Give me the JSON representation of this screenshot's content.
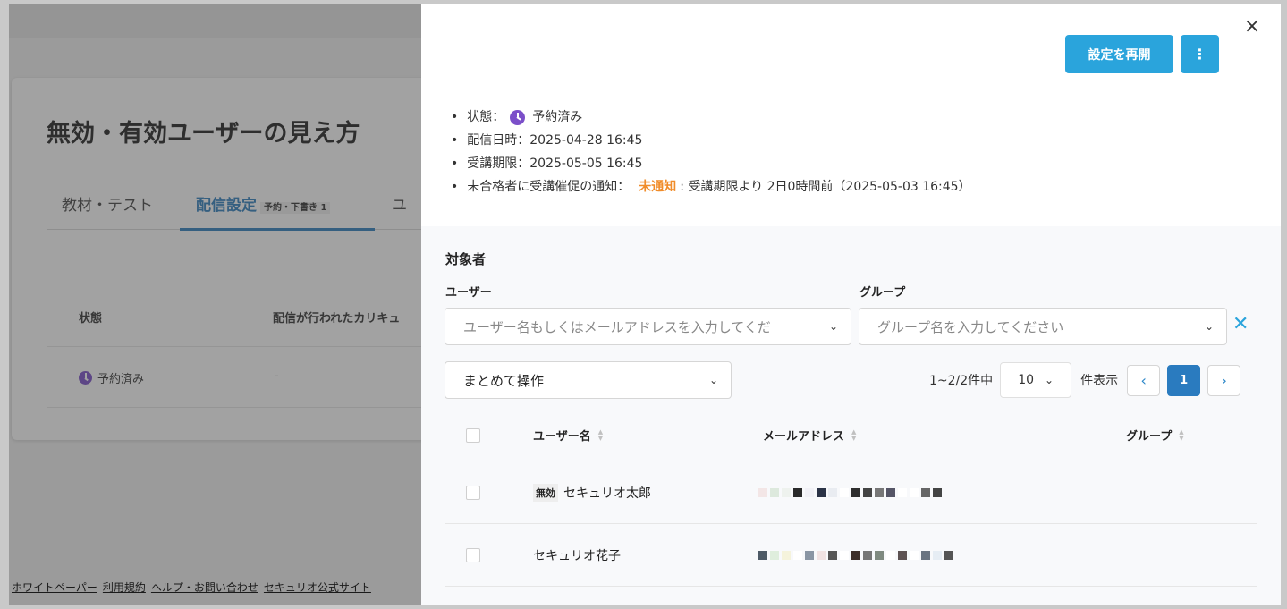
{
  "background": {
    "page_title": "無効・有効ユーザーの見え方",
    "tabs": [
      {
        "label": "教材・テスト"
      },
      {
        "label": "配信設定",
        "badge": "予約・下書き 1"
      },
      {
        "label": "ユ"
      }
    ],
    "table_headers": [
      "状態",
      "配信が行われたカリキュ"
    ],
    "row": {
      "status": "予約済み",
      "curriculum": "-"
    },
    "footer_links": [
      "ホワイトペーパー",
      "利用規約",
      "ヘルプ・お問い合わせ",
      "セキュリオ公式サイト"
    ]
  },
  "drawer": {
    "close_icon": "×",
    "resume_button": "設定を再開",
    "more_button": "⋮",
    "info": {
      "status_label": "状態：",
      "status_value": "予約済み",
      "delivery_label": "配信日時：",
      "delivery_value": "2025-04-28 16:45",
      "deadline_label": "受講期限：",
      "deadline_value": "2025-05-05 16:45",
      "reminder_label": "未合格者に受講催促の通知：",
      "reminder_status": "未通知",
      "reminder_detail": ": 受講期限より 2日0時間前（2025-05-03 16:45）"
    },
    "target_section": "対象者",
    "user_label": "ユーザー",
    "user_placeholder": "ユーザー名もしくはメールアドレスを入力してくだ",
    "group_label": "グループ",
    "group_placeholder": "グループ名を入力してください",
    "bulk_action": "まとめて操作",
    "paging": {
      "count_text": "1~2/2件中",
      "page_size": "10",
      "per_page_suffix": "件表示",
      "current_page": "1",
      "prev_icon": "‹",
      "next_icon": "›"
    },
    "table": {
      "columns": [
        "ユーザー名",
        "メールアドレス",
        "グループ"
      ],
      "rows": [
        {
          "tag": "無効",
          "name": "セキュリオ太郎",
          "email": "(redacted)",
          "group": ""
        },
        {
          "tag": "",
          "name": "セキュリオ花子",
          "email": "(redacted)",
          "group": ""
        }
      ]
    }
  },
  "colors": {
    "accent_blue": "#2aa4dc",
    "active_page": "#2a7bbf",
    "status_purple": "#7b4fc9",
    "warning_orange": "#f08c2a"
  }
}
